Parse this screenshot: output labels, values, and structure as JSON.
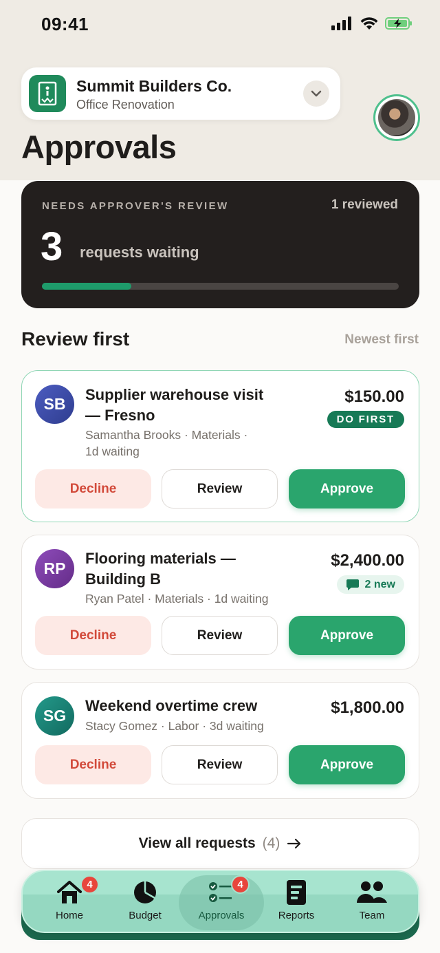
{
  "status_bar": {
    "time": "09:41"
  },
  "project": {
    "name": "Summit Builders Co.",
    "subtitle": "Office Renovation"
  },
  "page": {
    "title": "Approvals"
  },
  "summary": {
    "label": "NEEDS APPROVER'S REVIEW",
    "reviewed": "1 reviewed",
    "count": "3",
    "caption": "requests waiting",
    "progress_fraction": 0.25
  },
  "section": {
    "title": "Review first",
    "sort": "Newest first"
  },
  "requests": [
    {
      "initials": "SB",
      "avatar_color": "#3f4fa8",
      "title_line1": "Supplier warehouse visit",
      "title_line2": "— Fresno",
      "meta_line1": "Samantha Brooks · Materials ·",
      "meta_line2": "1d waiting",
      "amount": "$150.00",
      "badge": "DO FIRST",
      "decline": "Decline",
      "review": "Review",
      "approve": "Approve"
    },
    {
      "initials": "RP",
      "avatar_color": "#7f3fa6",
      "title_line1": "Flooring materials —",
      "title_line2": "Building B",
      "meta_line1": "Ryan Patel · Materials · 1d waiting",
      "amount": "$2,400.00",
      "badge": "2 new",
      "badge_icon": "chat-bubble-icon",
      "decline": "Decline",
      "review": "Review",
      "approve": "Approve"
    },
    {
      "initials": "SG",
      "avatar_color": "#1c8679",
      "title_line1": "Weekend overtime crew",
      "meta_line1": "Stacy Gomez · Labor · 3d waiting",
      "amount": "$1,800.00",
      "decline": "Decline",
      "review": "Review",
      "approve": "Approve"
    }
  ],
  "view_all": {
    "label": "View all requests",
    "count": "(4)"
  },
  "tabs": [
    {
      "label": "Home",
      "icon": "home-icon",
      "badge": "4"
    },
    {
      "label": "Budget",
      "icon": "pie-chart-icon"
    },
    {
      "label": "Approvals",
      "icon": "checklist-icon",
      "badge": "4",
      "active": true
    },
    {
      "label": "Reports",
      "icon": "report-icon"
    },
    {
      "label": "Team",
      "icon": "team-icon"
    }
  ],
  "colors": {
    "accent": "#2aa56d",
    "accent_dark": "#177a56",
    "decline": "#d24a3a",
    "badge_red": "#e8453c"
  }
}
